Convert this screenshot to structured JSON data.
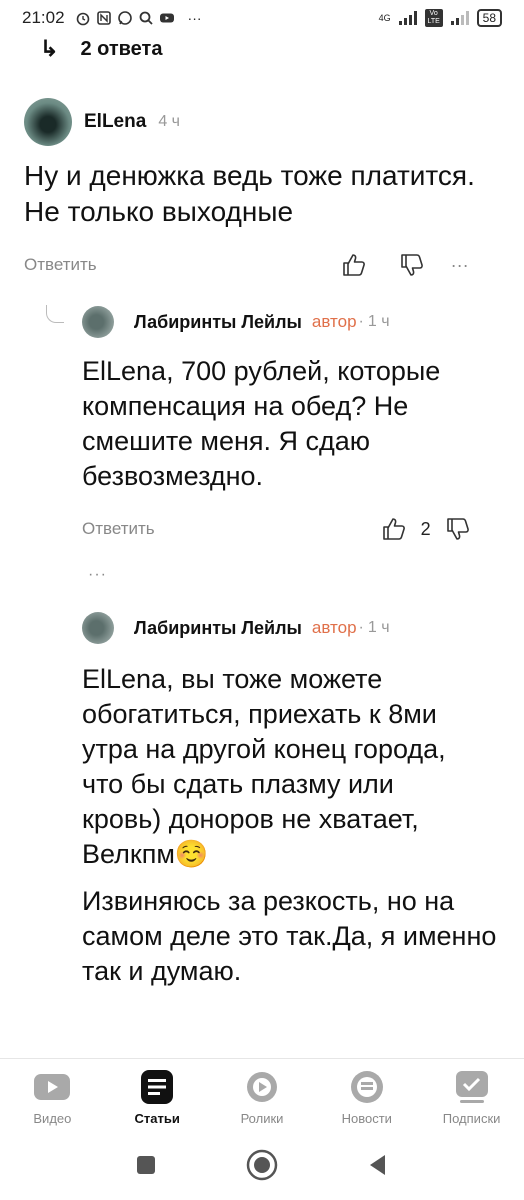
{
  "status_bar": {
    "time": "21:02",
    "network": "4G",
    "network2": "Vo LTE",
    "battery": "58",
    "more": "···"
  },
  "replies_link": {
    "arrow": "↳",
    "label": "2 ответа"
  },
  "comment1": {
    "author": "ElLena",
    "time": "4 ч",
    "text": "Ну и денюжка ведь тоже платится. Не только выходные",
    "reply_label": "Ответить",
    "more": "···"
  },
  "reply1": {
    "author": "Лабиринты Лейлы",
    "author_tag": "автор",
    "time_sep": "·",
    "time": "1 ч",
    "text": "ElLena, 700 рублей, которые компенсация на обед? Не смешите меня. Я сдаю безвозмездно.",
    "reply_label": "Ответить",
    "like_count": "2"
  },
  "show_more": "···",
  "reply2": {
    "author": "Лабиринты Лейлы",
    "author_tag": "автор",
    "time_sep": "·",
    "time": "1 ч",
    "paragraph1": "ElLena, вы тоже можете обогатиться, приехать к 8ми утра на другой конец города, что бы сдать плазму или кровь) доноров не хватает, Велкпм☺️",
    "paragraph2": "Извиняюсь за резкость, но на самом деле это так.Да, я именно так и думаю."
  },
  "bottom_nav": {
    "items": [
      {
        "label": "Видео",
        "icon": "video-icon"
      },
      {
        "label": "Статьи",
        "icon": "articles-icon",
        "active": true
      },
      {
        "label": "Ролики",
        "icon": "clips-icon"
      },
      {
        "label": "Новости",
        "icon": "news-icon"
      },
      {
        "label": "Подписки",
        "icon": "subscriptions-icon"
      }
    ]
  },
  "colors": {
    "author_tag": "#e0704a",
    "muted": "#888888",
    "text": "#111111"
  }
}
